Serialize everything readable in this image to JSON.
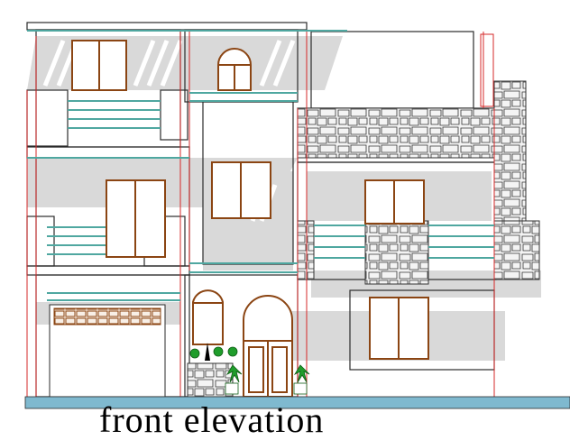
{
  "caption": "front elevation",
  "colors": {
    "background": "#ffffff",
    "outline": "#2b2b2b",
    "grid_red": "#d62828",
    "railing_teal": "#4fa7a0",
    "window_frame": "#8b4513",
    "shadow_gray": "#d9d9d9",
    "ground_blue": "#7fb9cf",
    "plant_green": "#1f9d2b"
  },
  "icons": [
    "window-icon",
    "arched-window-icon",
    "door-icon",
    "garage-door-icon",
    "stone-wall-icon",
    "railing-icon",
    "potted-plant-icon",
    "lamp-icon"
  ]
}
